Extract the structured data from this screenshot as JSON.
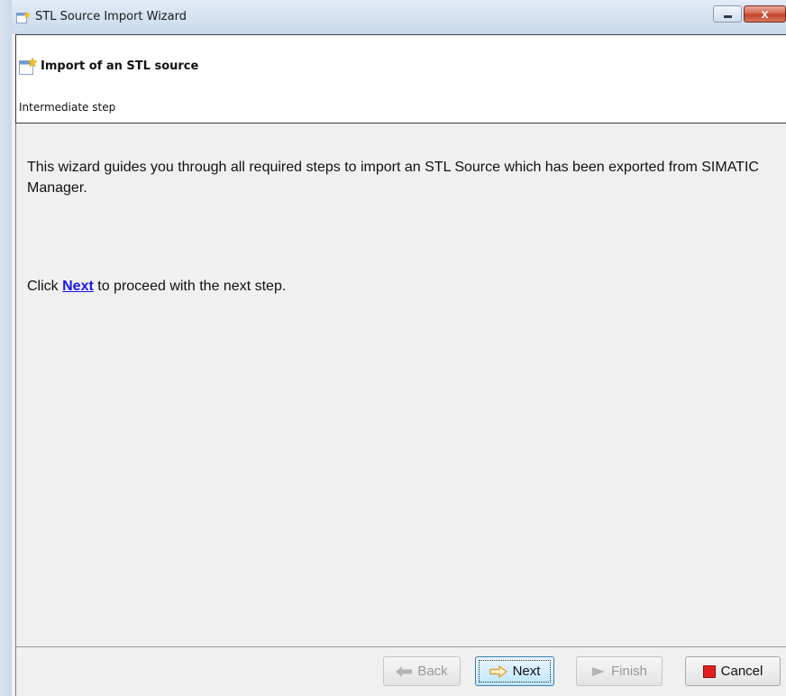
{
  "window": {
    "title": "STL Source Import Wizard",
    "icon": "wizard-icon",
    "controls": {
      "minimize": "minimize-icon",
      "close_label": "x"
    }
  },
  "header": {
    "icon": "wizard-page-icon",
    "title": "Import of an STL source",
    "subtitle": "Intermediate step"
  },
  "content": {
    "description": "This wizard guides you through all required steps to import an STL Source which has been exported from SIMATIC Manager.",
    "instruction_prefix": "Click",
    "instruction_link": "Next",
    "instruction_suffix": "to proceed with the next step."
  },
  "buttons": {
    "back": {
      "label": "Back",
      "enabled": false,
      "icon": "arrow-left-icon"
    },
    "next": {
      "label": "Next",
      "enabled": true,
      "icon": "arrow-right-icon",
      "color": "#f0a020"
    },
    "finish": {
      "label": "Finish",
      "enabled": false,
      "icon": "play-icon"
    },
    "cancel": {
      "label": "Cancel",
      "enabled": true,
      "icon": "stop-icon",
      "color": "#e02020"
    }
  }
}
